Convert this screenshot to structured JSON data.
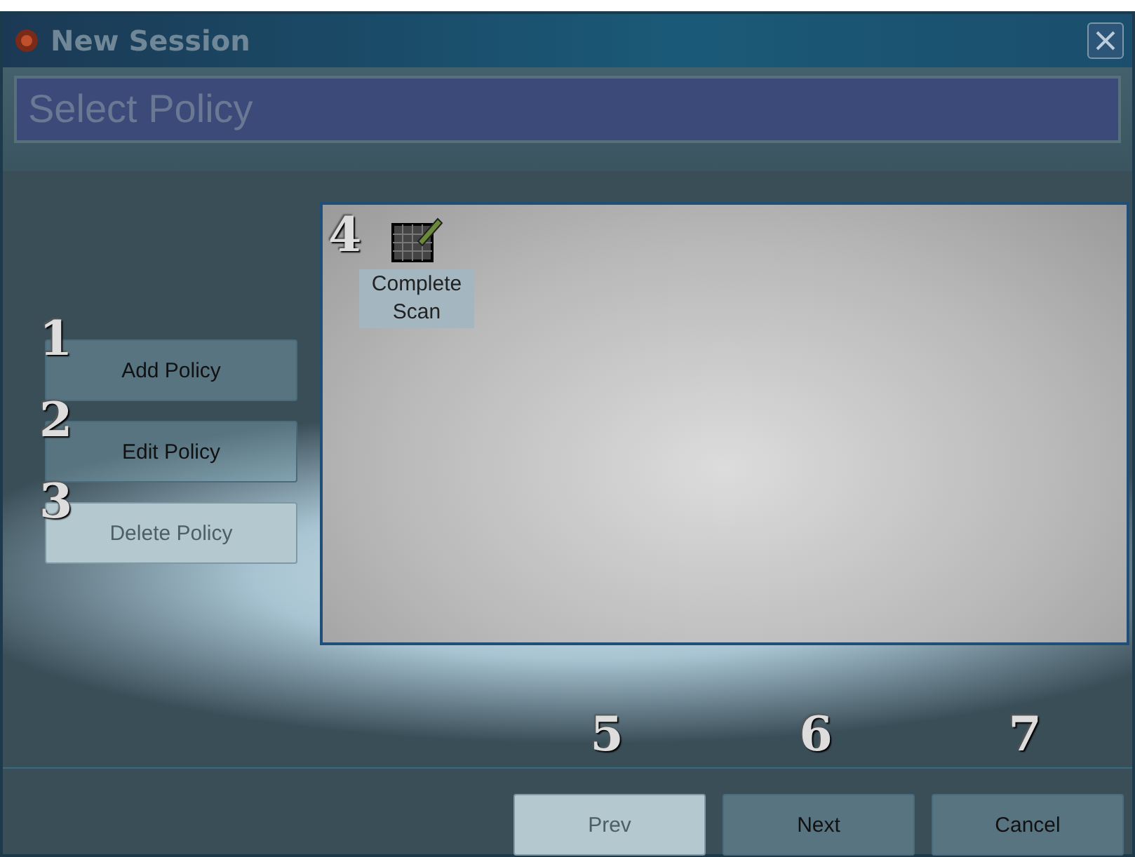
{
  "window": {
    "title": "New Session"
  },
  "header": {
    "title": "Select Policy"
  },
  "policy_buttons": [
    {
      "label": "Add Policy",
      "disabled": false,
      "callout": "1"
    },
    {
      "label": "Edit Policy",
      "disabled": false,
      "callout": "2"
    },
    {
      "label": "Delete Policy",
      "disabled": true,
      "callout": "3"
    }
  ],
  "policies": [
    {
      "label": "Complete Scan",
      "selected": true,
      "callout": "4"
    }
  ],
  "footer_buttons": [
    {
      "label": "Prev",
      "disabled": true,
      "callout": "5"
    },
    {
      "label": "Next",
      "disabled": false,
      "callout": "6"
    },
    {
      "label": "Cancel",
      "disabled": false,
      "callout": "7"
    }
  ]
}
